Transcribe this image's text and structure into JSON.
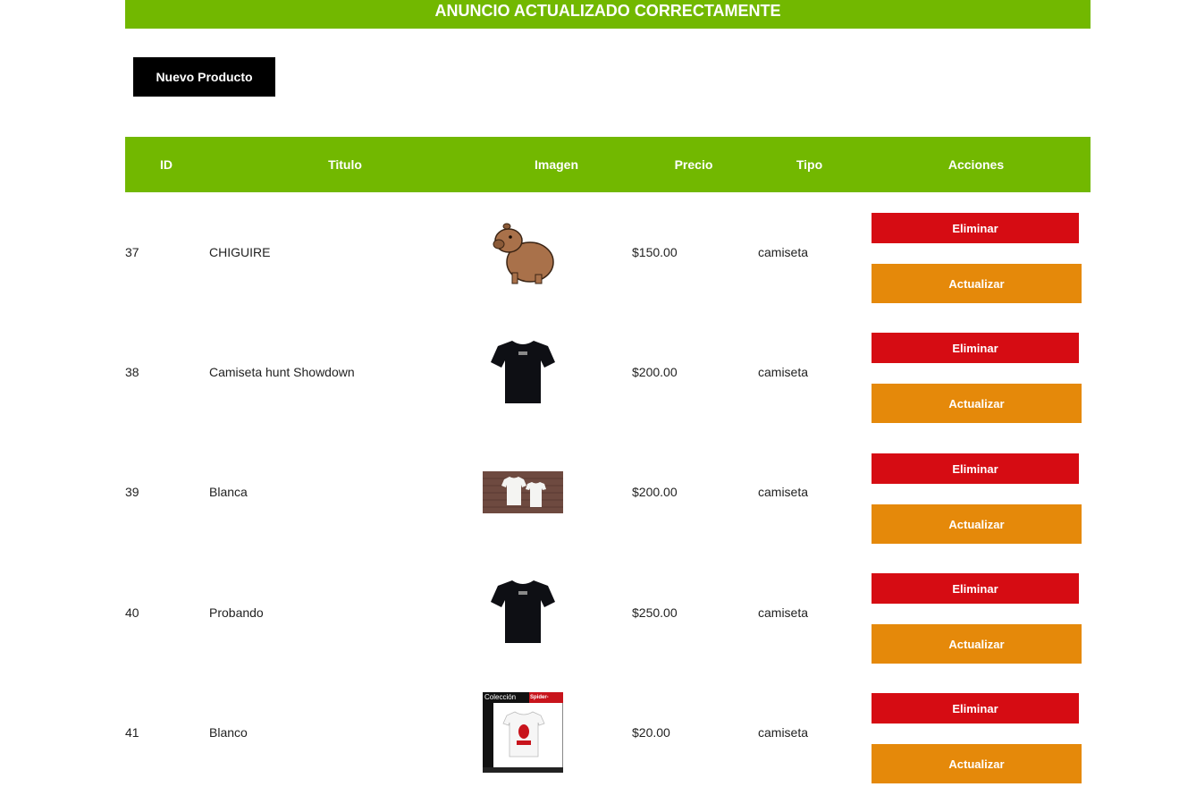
{
  "banner": {
    "message": "ANUNCIO ACTUALIZADO CORRECTAMENTE"
  },
  "toolbar": {
    "new_product_label": "Nuevo Producto"
  },
  "table": {
    "headers": {
      "id": "ID",
      "title": "Titulo",
      "image": "Imagen",
      "price": "Precio",
      "type": "Tipo",
      "actions": "Acciones"
    },
    "actions": {
      "delete_label": "Eliminar",
      "update_label": "Actualizar"
    },
    "rows": [
      {
        "id": "37",
        "title": "CHIGUIRE",
        "image": "capybara-illustration",
        "price": "$150.00",
        "type": "camiseta"
      },
      {
        "id": "38",
        "title": "Camiseta hunt Showdown",
        "image": "black-tshirt",
        "price": "$200.00",
        "type": "camiseta"
      },
      {
        "id": "39",
        "title": "Blanca",
        "image": "white-tshirts-on-brick-wall",
        "price": "$200.00",
        "type": "camiseta"
      },
      {
        "id": "40",
        "title": "Probando",
        "image": "black-tshirt",
        "price": "$250.00",
        "type": "camiseta"
      },
      {
        "id": "41",
        "title": "Blanco",
        "image": "spiderman-white-tshirt-ad",
        "price": "$20.00",
        "type": "camiseta"
      }
    ]
  },
  "thumb_text": {
    "ad_collection": "Colección",
    "ad_brand": "Spider-Mania"
  },
  "colors": {
    "accent_green": "#72b800",
    "delete_red": "#d60c13",
    "update_orange": "#e5890a",
    "new_button_black": "#000000"
  }
}
